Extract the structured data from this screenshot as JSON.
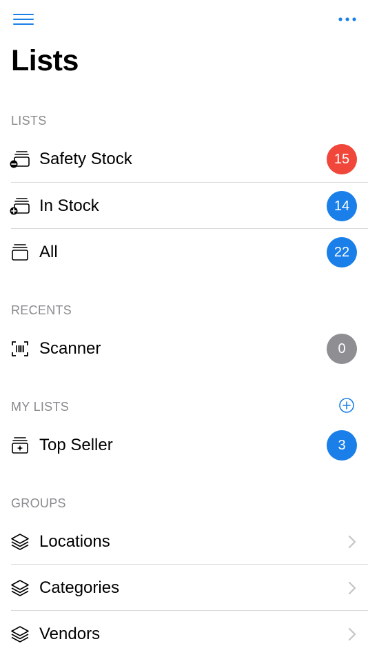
{
  "colors": {
    "accent": "#1a7fe8",
    "badge_red": "#f0473a",
    "badge_blue": "#1a7fe8",
    "badge_gray": "#8e8e93",
    "section_text": "#8a8a8e",
    "chevron": "#c4c4c7"
  },
  "topbar": {
    "menu_icon": "hamburger-icon",
    "more_icon": "ellipsis-icon"
  },
  "page_title": "Lists",
  "sections": {
    "lists": {
      "header": "LISTS",
      "items": [
        {
          "label": "Safety Stock",
          "count": "15",
          "badge_color": "red",
          "icon": "stack-minus-icon"
        },
        {
          "label": "In Stock",
          "count": "14",
          "badge_color": "blue",
          "icon": "stack-plus-icon"
        },
        {
          "label": "All",
          "count": "22",
          "badge_color": "blue",
          "icon": "stack-icon"
        }
      ]
    },
    "recents": {
      "header": "RECENTS",
      "items": [
        {
          "label": "Scanner",
          "count": "0",
          "badge_color": "gray",
          "icon": "barcode-scanner-icon"
        }
      ]
    },
    "my_lists": {
      "header": "MY LISTS",
      "add_icon": "plus-circle-icon",
      "items": [
        {
          "label": "Top Seller",
          "count": "3",
          "badge_color": "blue",
          "icon": "stack-star-icon"
        }
      ]
    },
    "groups": {
      "header": "GROUPS",
      "items": [
        {
          "label": "Locations",
          "icon": "layers-icon"
        },
        {
          "label": "Categories",
          "icon": "layers-icon"
        },
        {
          "label": "Vendors",
          "icon": "layers-icon"
        }
      ]
    }
  }
}
